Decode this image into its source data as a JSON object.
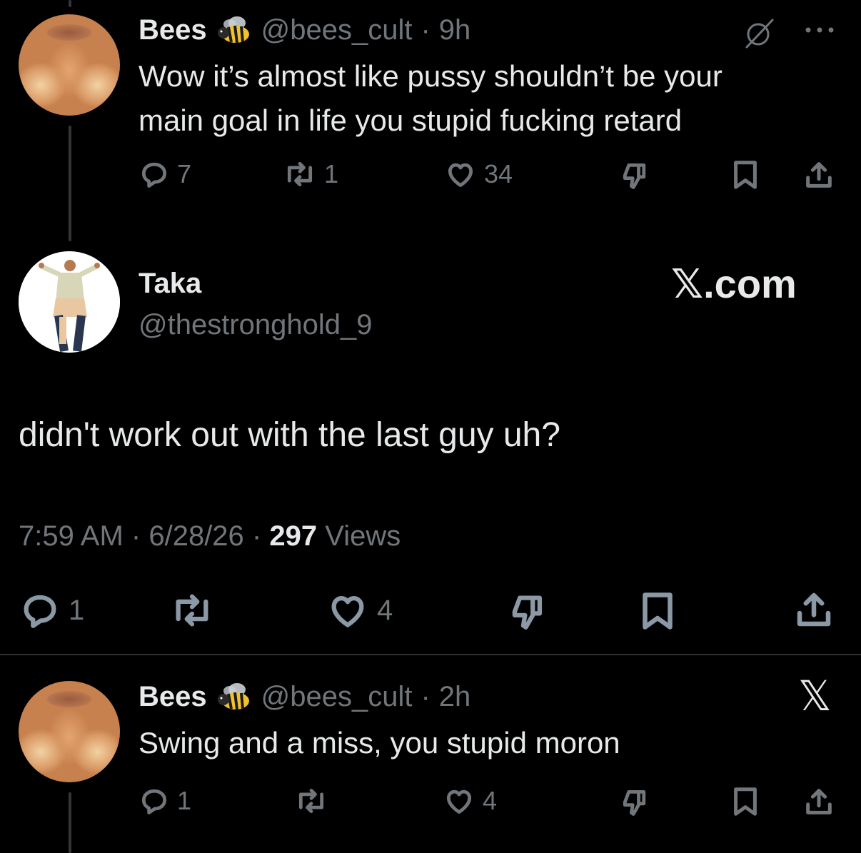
{
  "tweet1": {
    "name": "Bees",
    "name_emoji": "bee",
    "handle": "@bees_cult",
    "sep": "·",
    "time": "9h",
    "text_line1": "Wow it’s almost like pussy shouldn’t be your",
    "text_line2": "main goal in life you stupid fucking retard",
    "replies": "7",
    "reposts": "1",
    "likes": "34"
  },
  "main_tweet": {
    "name": "Taka",
    "handle": "@thestronghold_9",
    "watermark": "𝕏.com",
    "text": "didn't work out with the last guy uh?",
    "time": "7:59 AM",
    "date": "6/28/26",
    "sep": "·",
    "views_count": "297",
    "views_label": "Views",
    "replies": "1",
    "likes": "4"
  },
  "tweet3": {
    "name": "Bees",
    "handle": "@bees_cult",
    "sep": "·",
    "time": "2h",
    "x_logo": "𝕏",
    "text": "Swing and a miss, you stupid moron",
    "replies": "1",
    "likes": "4"
  },
  "icons": [
    "grok-icon",
    "more-icon",
    "reply-icon",
    "repost-icon",
    "like-icon",
    "dislike-icon",
    "bookmark-icon",
    "share-icon",
    "x-logo-icon"
  ],
  "colors": {
    "background": "#000000",
    "text": "#e7e9ea",
    "muted": "#71767b",
    "divider": "#2f3336"
  }
}
